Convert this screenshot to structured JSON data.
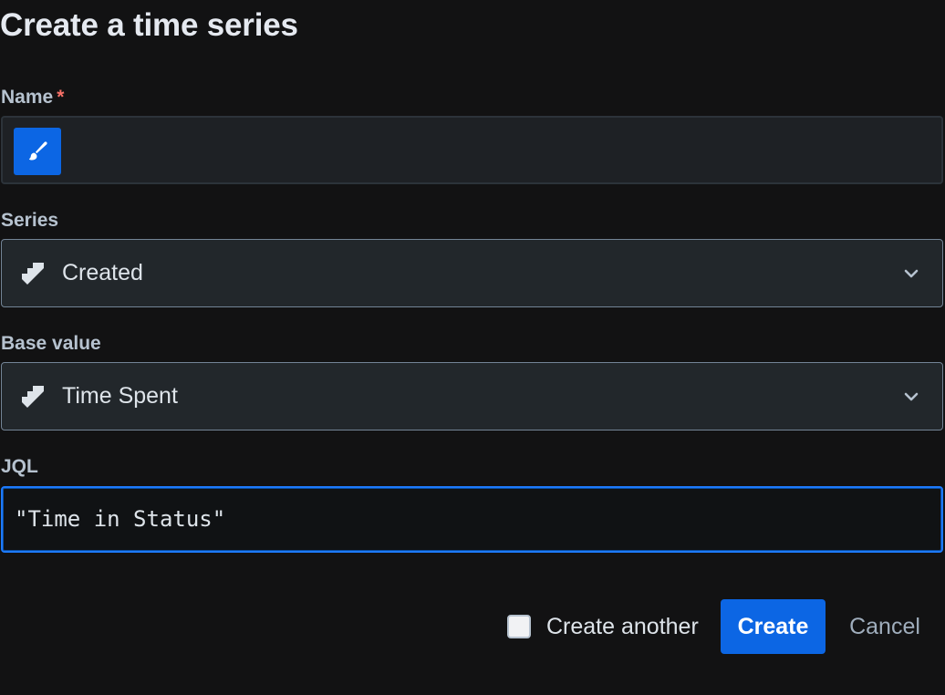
{
  "dialog": {
    "title": "Create a time series"
  },
  "fields": {
    "name": {
      "label": "Name",
      "required_marker": "*",
      "value": "",
      "icon": "paintbrush-icon",
      "icon_bg": "#0c66e4"
    },
    "series": {
      "label": "Series",
      "selected": "Created",
      "icon": "jira-icon"
    },
    "base_value": {
      "label": "Base value",
      "selected": "Time Spent",
      "icon": "jira-icon"
    },
    "jql": {
      "label": "JQL",
      "value": "\"Time in Status\""
    }
  },
  "footer": {
    "create_another_label": "Create another",
    "create_another_checked": false,
    "create_label": "Create",
    "cancel_label": "Cancel"
  },
  "colors": {
    "background": "#121213",
    "accent": "#0c66e4",
    "focus_border": "#1d7afc",
    "required": "#f87168"
  }
}
